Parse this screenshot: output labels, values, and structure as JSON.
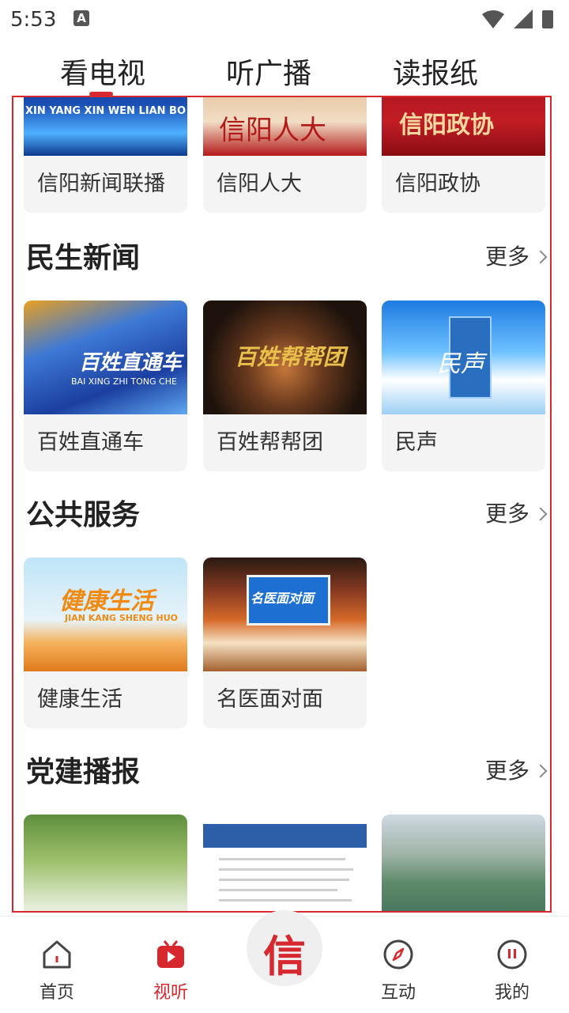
{
  "status_bar": {
    "time": "5:53",
    "notif_letter": "A"
  },
  "top_tabs": [
    "看电视",
    "听广播",
    "读报纸"
  ],
  "row1": [
    {
      "label": "信阳新闻联播",
      "thumb_text": "XIN YANG XIN WEN LIAN BO"
    },
    {
      "label": "信阳人大",
      "thumb_text": "信阳人大"
    },
    {
      "label": "信阳政协",
      "thumb_text": "信阳政协"
    }
  ],
  "sections": [
    {
      "title": "民生新闻",
      "more": "更多",
      "items": [
        {
          "label": "百姓直通车",
          "thumb_text": "百姓直通车",
          "thumb_sub": "BAI XING ZHI TONG CHE"
        },
        {
          "label": "百姓帮帮团",
          "thumb_text": "百姓帮帮团"
        },
        {
          "label": "民声",
          "thumb_text": "民声"
        }
      ]
    },
    {
      "title": "公共服务",
      "more": "更多",
      "items": [
        {
          "label": "健康生活",
          "thumb_text": "健康生活",
          "thumb_sub": "JIAN KANG SHENG HUO"
        },
        {
          "label": "名医面对面",
          "thumb_text": "名医面对面"
        }
      ]
    },
    {
      "title": "党建播报",
      "more": "更多"
    }
  ],
  "bottom_nav": {
    "items": [
      {
        "label": "首页",
        "icon": "home-icon"
      },
      {
        "label": "视听",
        "icon": "tv-icon"
      },
      {
        "label": "互动",
        "icon": "compass-icon"
      },
      {
        "label": "我的",
        "icon": "user-icon"
      }
    ],
    "center_glyph": "信"
  },
  "colors": {
    "accent": "#d7282f",
    "card_bg": "#f4f4f4"
  }
}
